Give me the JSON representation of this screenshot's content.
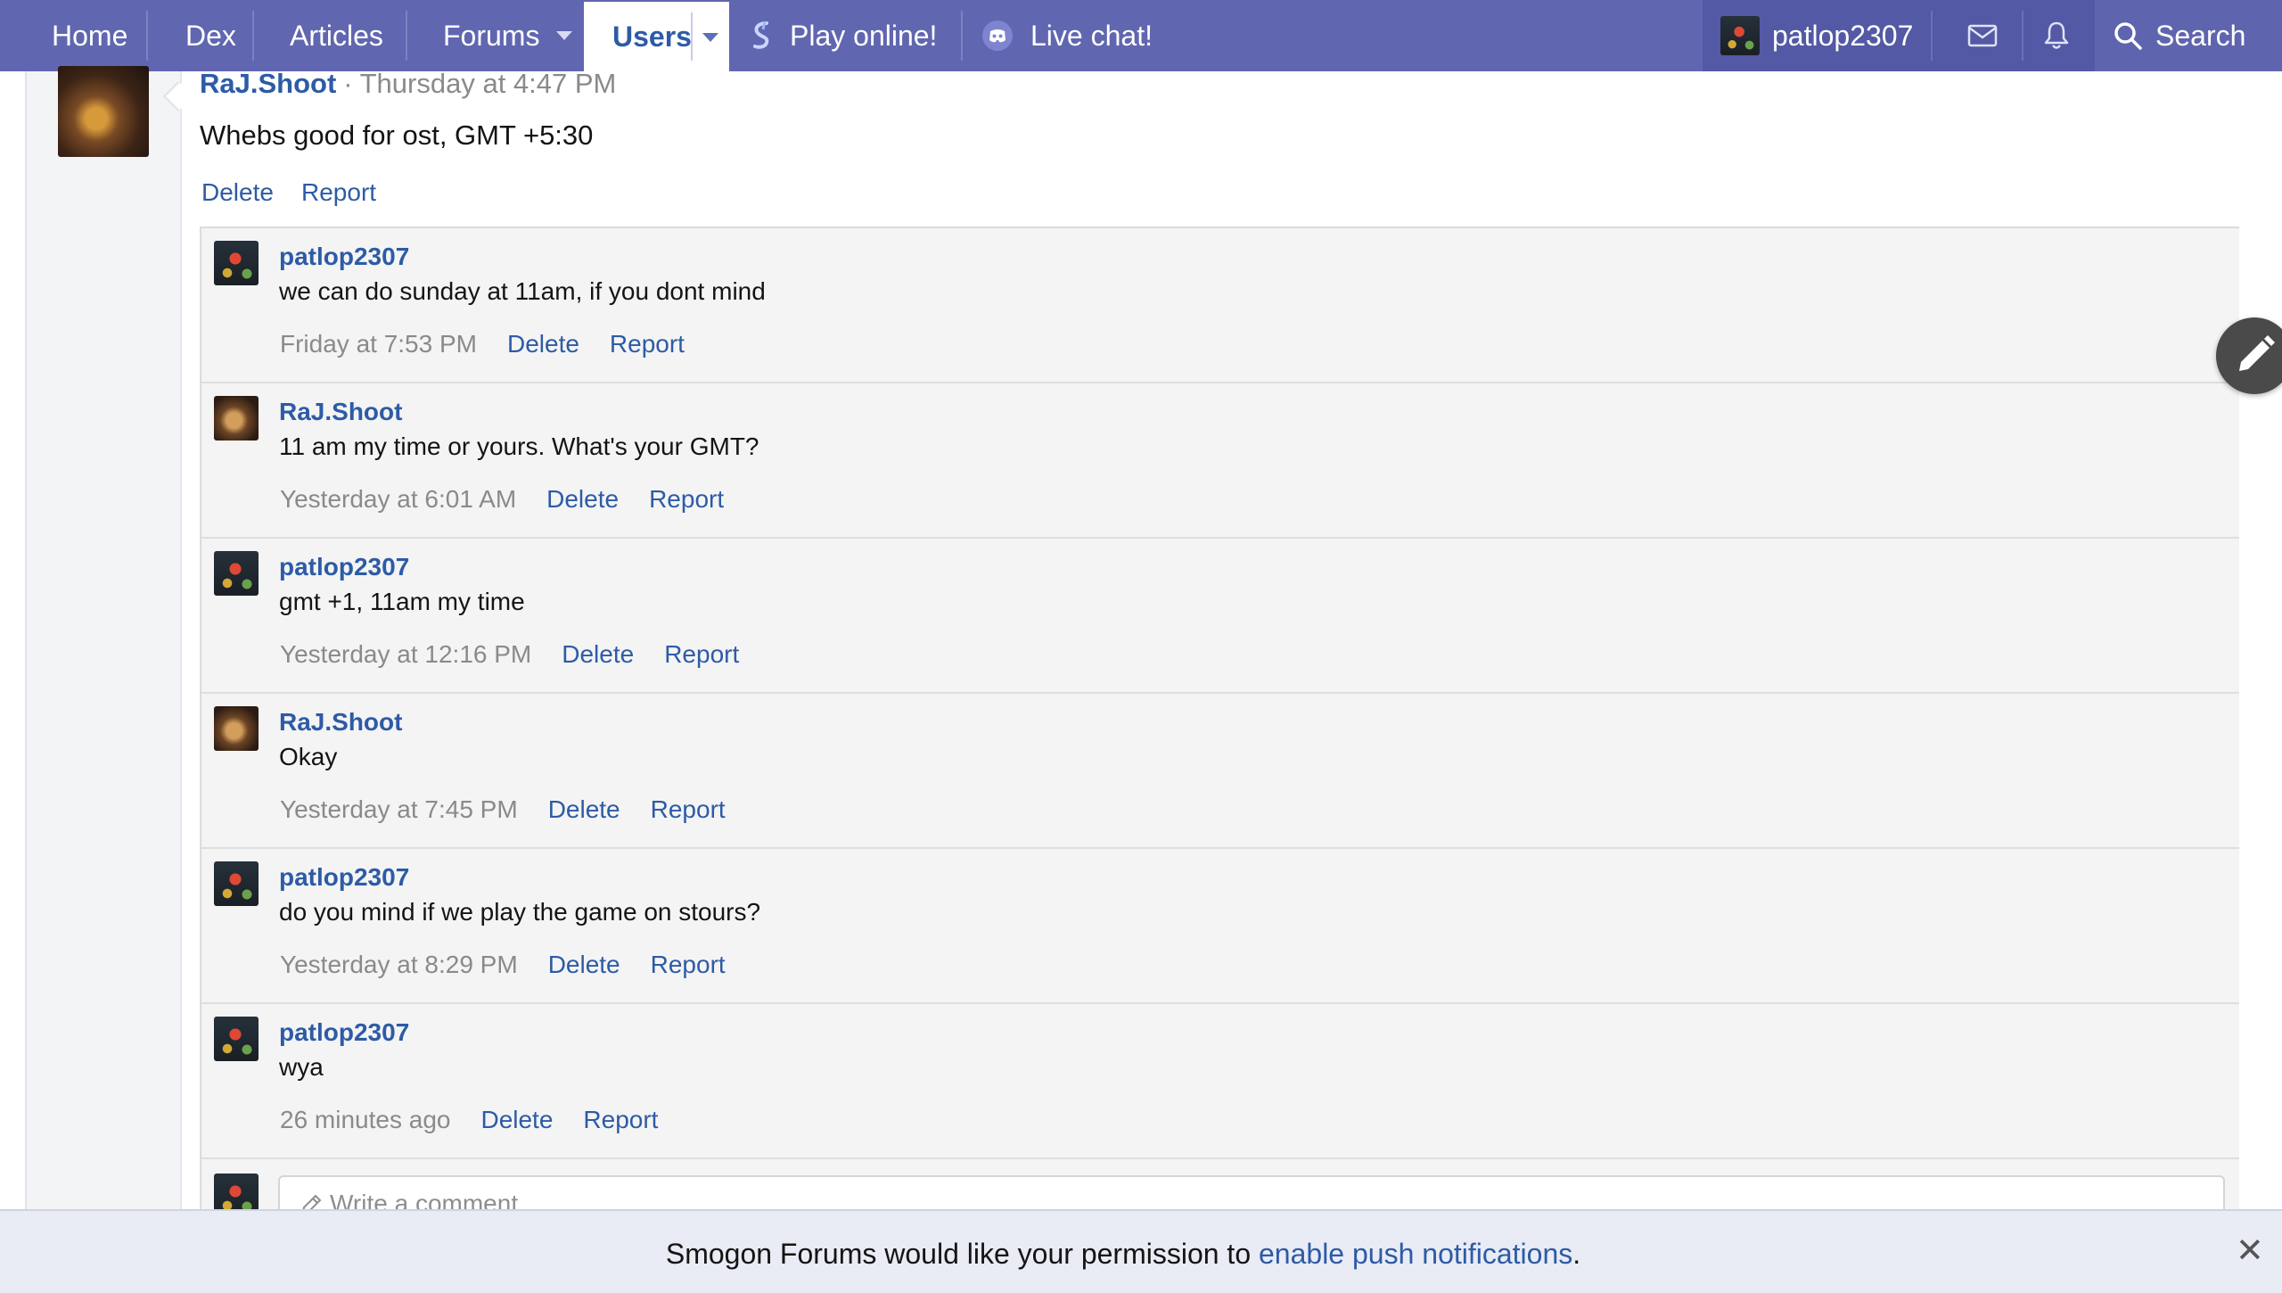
{
  "nav": {
    "home": "Home",
    "dex": "Dex",
    "articles": "Articles",
    "forums": "Forums",
    "users": "Users",
    "play_online": "Play online!",
    "live_chat": "Live chat!",
    "username": "patlop2307",
    "search": "Search"
  },
  "post": {
    "author": "RaJ.Shoot",
    "separator": "·",
    "time": "Thursday at 4:47 PM",
    "body": "Whebs good for ost, GMT +5:30",
    "delete": "Delete",
    "report": "Report"
  },
  "comments": [
    {
      "author": "patlop2307",
      "text": "we can do sunday at 11am, if you dont mind",
      "time": "Friday at 7:53 PM",
      "delete": "Delete",
      "report": "Report"
    },
    {
      "author": "RaJ.Shoot",
      "text": "11 am my time or yours. What's your GMT?",
      "time": "Yesterday at 6:01 AM",
      "delete": "Delete",
      "report": "Report"
    },
    {
      "author": "patlop2307",
      "text": "gmt +1, 11am my time",
      "time": "Yesterday at 12:16 PM",
      "delete": "Delete",
      "report": "Report"
    },
    {
      "author": "RaJ.Shoot",
      "text": "Okay",
      "time": "Yesterday at 7:45 PM",
      "delete": "Delete",
      "report": "Report"
    },
    {
      "author": "patlop2307",
      "text": "do you mind if we play the game on stours?",
      "time": "Yesterday at 8:29 PM",
      "delete": "Delete",
      "report": "Report"
    },
    {
      "author": "patlop2307",
      "text": "wya",
      "time": "26 minutes ago",
      "delete": "Delete",
      "report": "Report"
    }
  ],
  "write_comment": {
    "placeholder": "Write a comment..."
  },
  "push": {
    "message": "Smogon Forums would like your permission to ",
    "link": "enable push notifications",
    "end": ".",
    "close": "✕"
  },
  "colors": {
    "nav_bg": "#6166b0",
    "link": "#2d5ba6",
    "muted": "#8a8a8a"
  }
}
